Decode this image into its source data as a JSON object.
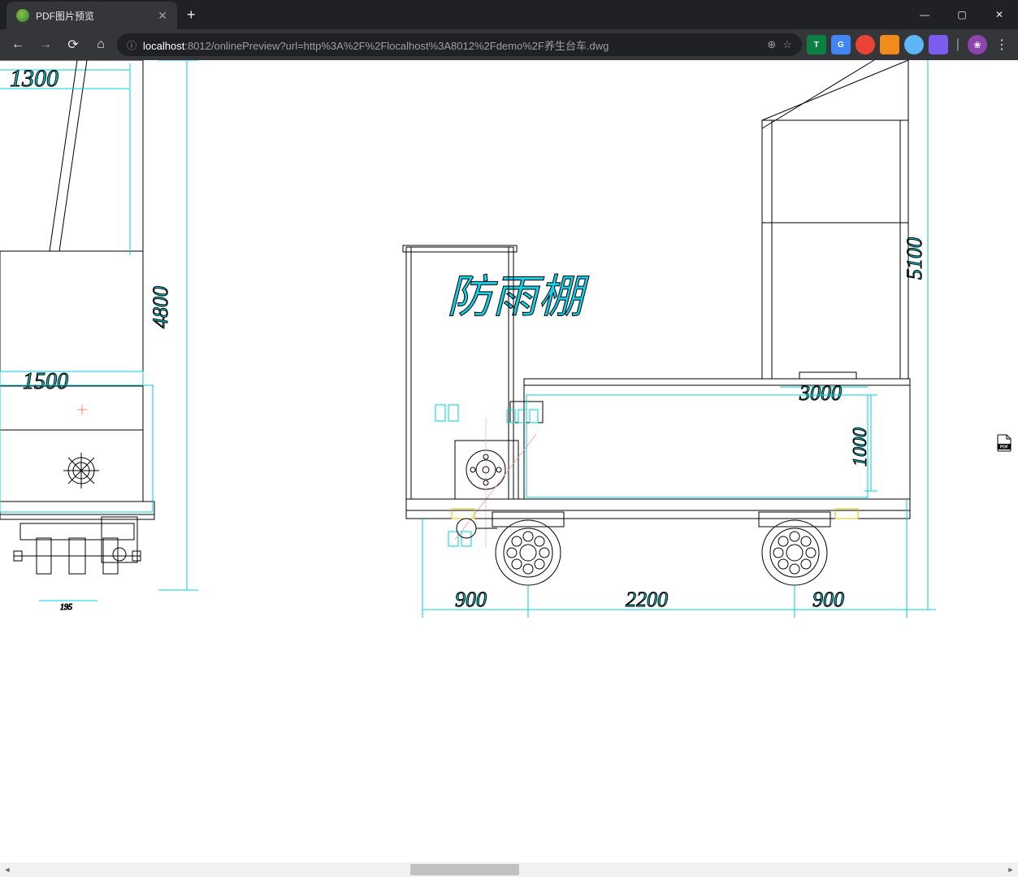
{
  "window": {
    "tab_title": "PDF图片预览",
    "new_tab": "+",
    "minimize": "—",
    "maximize": "▢",
    "close": "✕"
  },
  "toolbar": {
    "back": "←",
    "forward": "→",
    "reload": "⟳",
    "home": "⌂",
    "secure_icon": "ⓘ",
    "url_host": "localhost",
    "url_path": ":8012/onlinePreview?url=http%3A%2F%2Flocalhost%3A8012%2Fdemo%2F养生台车.dwg",
    "search_icon": "⊕",
    "star_icon": "☆",
    "menu": "⋮"
  },
  "drawing": {
    "main_label": "防雨棚",
    "dims": {
      "d1300": "1300",
      "d1500": "1500",
      "d4800": "4800",
      "d5100": "5100",
      "d3000": "3000",
      "d1000": "1000",
      "d900a": "900",
      "d2200": "2200",
      "d900b": "900",
      "d195": "195"
    }
  },
  "pdf_badge": "PDF"
}
